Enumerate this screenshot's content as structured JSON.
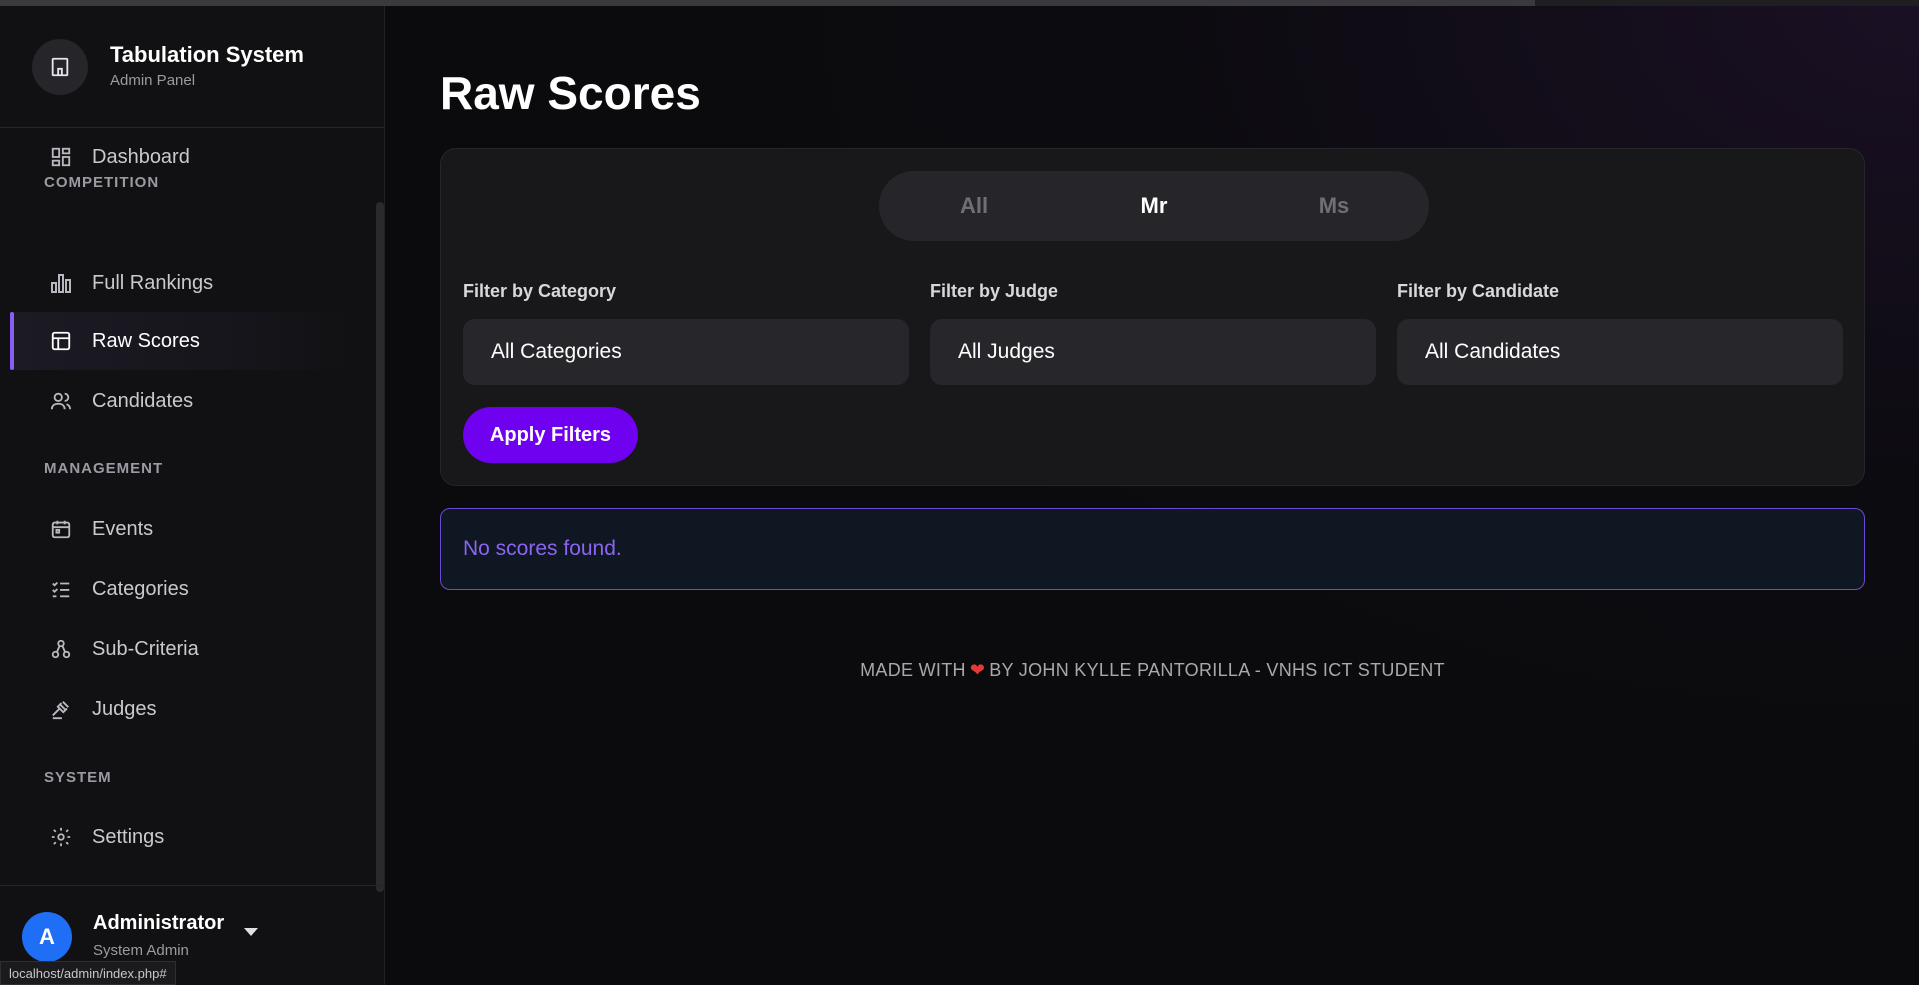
{
  "app": {
    "title": "Tabulation System",
    "subtitle": "Admin Panel"
  },
  "sidebar": {
    "dashboard": "Dashboard",
    "sections": {
      "competition": "COMPETITION",
      "management": "MANAGEMENT",
      "system": "SYSTEM"
    },
    "items": {
      "full_rankings": "Full Rankings",
      "raw_scores": "Raw Scores",
      "candidates": "Candidates",
      "events": "Events",
      "categories": "Categories",
      "sub_criteria": "Sub-Criteria",
      "judges": "Judges",
      "settings": "Settings"
    },
    "active_item": "raw_scores"
  },
  "user": {
    "initial": "A",
    "name": "Administrator",
    "role": "System Admin"
  },
  "status_url": "localhost/admin/index.php#",
  "main": {
    "title": "Raw Scores",
    "segments": [
      "All",
      "Mr",
      "Ms"
    ],
    "active_segment": "Mr",
    "filters": {
      "category": {
        "label": "Filter by Category",
        "value": "All Categories"
      },
      "judge": {
        "label": "Filter by Judge",
        "value": "All Judges"
      },
      "candidate": {
        "label": "Filter by Candidate",
        "value": "All Candidates"
      }
    },
    "apply_label": "Apply Filters",
    "empty_message": "No scores found."
  },
  "footer": {
    "prefix": "MADE WITH",
    "suffix": "BY JOHN KYLLE PANTORILLA - VNHS ICT STUDENT"
  },
  "colors": {
    "accent": "#8b5cf6",
    "primary_button": "#7000f0",
    "avatar": "#1e6ff5",
    "heart": "#e53935"
  }
}
